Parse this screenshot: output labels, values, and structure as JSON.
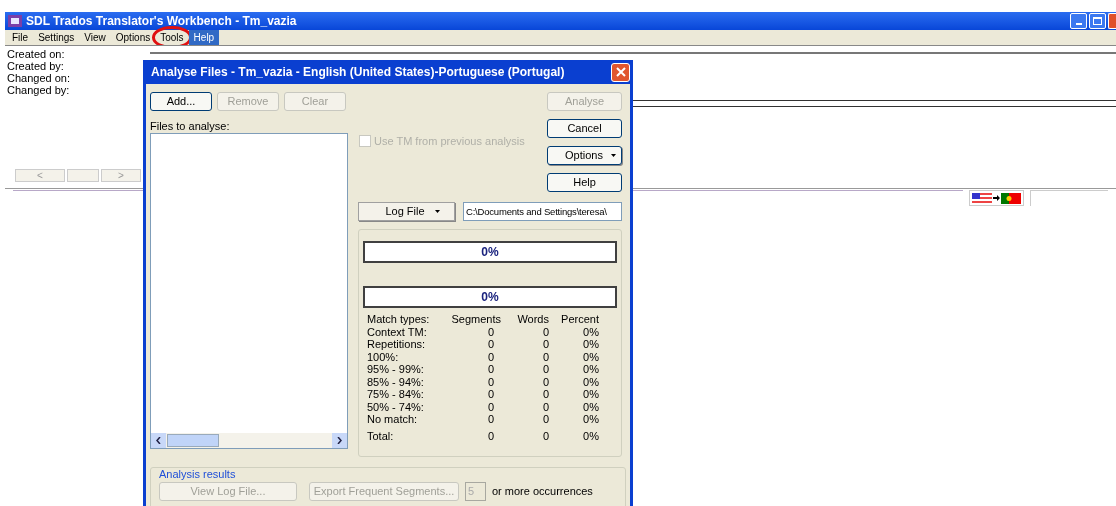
{
  "window": {
    "title": "SDL Trados Translator's Workbench - Tm_vazia"
  },
  "menu": [
    {
      "label": "File",
      "selected": false,
      "circled": false
    },
    {
      "label": "Settings",
      "selected": false,
      "circled": false
    },
    {
      "label": "View",
      "selected": false,
      "circled": false
    },
    {
      "label": "Options",
      "selected": false,
      "circled": false
    },
    {
      "label": "Tools",
      "selected": false,
      "circled": true
    },
    {
      "label": "Help",
      "selected": true,
      "circled": false
    }
  ],
  "info_labels": [
    "Created on:",
    "Created by:",
    "Changed on:",
    "Changed by:"
  ],
  "nav": {
    "previous": "<",
    "next": ">"
  },
  "dialog": {
    "title": "Analyse Files - Tm_vazia - English (United States)-Portuguese (Portugal)",
    "file_buttons": [
      {
        "label": "Add...",
        "disabled": false
      },
      {
        "label": "Remove",
        "disabled": true
      },
      {
        "label": "Clear",
        "disabled": true
      }
    ],
    "files_label": "Files to analyse:",
    "use_tm": {
      "label": "Use TM from previous analysis",
      "checked": false,
      "disabled": true
    },
    "side_buttons": [
      {
        "label": "Analyse",
        "kind": "plain",
        "disabled": true
      },
      {
        "label": "Cancel",
        "kind": "plain",
        "disabled": false
      },
      {
        "label": "Options",
        "kind": "dropdown",
        "disabled": false
      },
      {
        "label": "Help",
        "kind": "plain",
        "disabled": false
      }
    ],
    "log_file_button": "Log File",
    "log_path": "C:\\Documents and Settings\\teresa\\",
    "progress": [
      {
        "text": "0%",
        "level": 0
      },
      {
        "text": "0%",
        "level": 0
      }
    ],
    "stats": {
      "columns": [
        "Match types:",
        "Segments",
        "Words",
        "Percent"
      ],
      "rows": [
        {
          "kind": "row",
          "cells": [
            "Context TM:",
            "0",
            "0",
            "0%"
          ]
        },
        {
          "kind": "row",
          "cells": [
            "Repetitions:",
            "0",
            "0",
            "0%"
          ]
        },
        {
          "kind": "row",
          "cells": [
            "100%:",
            "0",
            "0",
            "0%"
          ]
        },
        {
          "kind": "row",
          "cells": [
            "95% - 99%:",
            "0",
            "0",
            "0%"
          ]
        },
        {
          "kind": "row",
          "cells": [
            "85% - 94%:",
            "0",
            "0",
            "0%"
          ]
        },
        {
          "kind": "row",
          "cells": [
            "75% - 84%:",
            "0",
            "0",
            "0%"
          ]
        },
        {
          "kind": "row",
          "cells": [
            "50% - 74%:",
            "0",
            "0",
            "0%"
          ]
        },
        {
          "kind": "row",
          "cells": [
            "No match:",
            "0",
            "0",
            "0%"
          ]
        },
        {
          "kind": "total",
          "cells": [
            "Total:",
            "0",
            "0",
            "0%"
          ]
        }
      ]
    },
    "results": {
      "title": "Analysis results",
      "buttons": [
        {
          "label": "View Log File...",
          "disabled": true
        },
        {
          "label": "Export Frequent Segments...",
          "disabled": true
        }
      ],
      "occurrences_value": "5",
      "occurrences_label": "or more occurrences"
    }
  }
}
